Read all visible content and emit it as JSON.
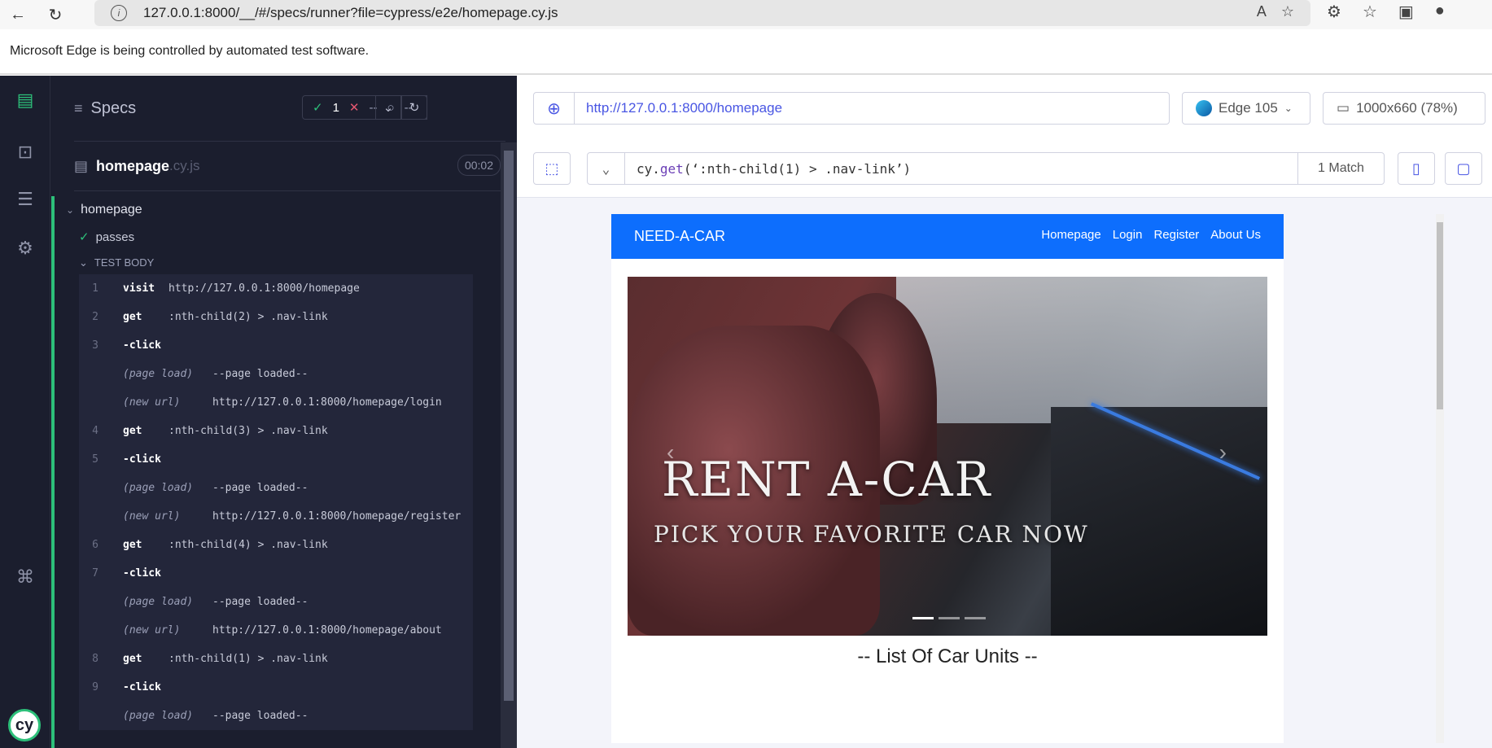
{
  "browser": {
    "url": "127.0.0.1:8000/__/#/specs/runner?file=cypress/e2e/homepage.cy.js",
    "automation_notice": "Microsoft Edge is being controlled by automated test software."
  },
  "reporter": {
    "specs_label": "Specs",
    "stats": {
      "passed": "1",
      "failed": "--",
      "pending": "--"
    },
    "file_name": "homepage",
    "file_ext": ".cy.js",
    "duration": "00:02",
    "suite": "homepage",
    "test": "passes",
    "body_label": "TEST BODY",
    "commands": [
      {
        "type": "cmd",
        "num": "1",
        "name": "visit",
        "msg": "http://127.0.0.1:8000/homepage"
      },
      {
        "type": "cmd",
        "num": "2",
        "name": "get",
        "msg": ":nth-child(2) > .nav-link"
      },
      {
        "type": "cmd",
        "num": "3",
        "name": "-click",
        "msg": ""
      },
      {
        "type": "event",
        "num": "",
        "name": "(page load)",
        "msg": "--page loaded--"
      },
      {
        "type": "event",
        "num": "",
        "name": "(new url)",
        "msg": "http://127.0.0.1:8000/homepage/login"
      },
      {
        "type": "cmd",
        "num": "4",
        "name": "get",
        "msg": ":nth-child(3) > .nav-link"
      },
      {
        "type": "cmd",
        "num": "5",
        "name": "-click",
        "msg": ""
      },
      {
        "type": "event",
        "num": "",
        "name": "(page load)",
        "msg": "--page loaded--"
      },
      {
        "type": "event",
        "num": "",
        "name": "(new url)",
        "msg": "http://127.0.0.1:8000/homepage/register"
      },
      {
        "type": "cmd",
        "num": "6",
        "name": "get",
        "msg": ":nth-child(4) > .nav-link"
      },
      {
        "type": "cmd",
        "num": "7",
        "name": "-click",
        "msg": ""
      },
      {
        "type": "event",
        "num": "",
        "name": "(page load)",
        "msg": "--page loaded--"
      },
      {
        "type": "event",
        "num": "",
        "name": "(new url)",
        "msg": "http://127.0.0.1:8000/homepage/about"
      },
      {
        "type": "cmd",
        "num": "8",
        "name": "get",
        "msg": ":nth-child(1) > .nav-link"
      },
      {
        "type": "cmd",
        "num": "9",
        "name": "-click",
        "msg": ""
      },
      {
        "type": "event",
        "num": "",
        "name": "(page load)",
        "msg": "--page loaded--"
      }
    ]
  },
  "aut": {
    "url": "http://127.0.0.1:8000/homepage",
    "browser": "Edge 105",
    "viewport": "1000x660 (78%)",
    "selector_prefix": "cy.",
    "selector_fn": "get",
    "selector_arg": "(‘:nth-child(1) > .nav-link’)",
    "match_count": "1 Match"
  },
  "site": {
    "brand": "NEED-A-CAR",
    "nav": [
      "Homepage",
      "Login",
      "Register",
      "About Us"
    ],
    "hero_title": "RENT A-CAR",
    "hero_subtitle": "PICK YOUR FAVORITE CAR NOW",
    "list_title": "-- List Of Car Units --"
  },
  "colors": {
    "accent": "#2dc07a",
    "brand_blue": "#0d6efd",
    "cypress_dark": "#1b1e2e"
  }
}
